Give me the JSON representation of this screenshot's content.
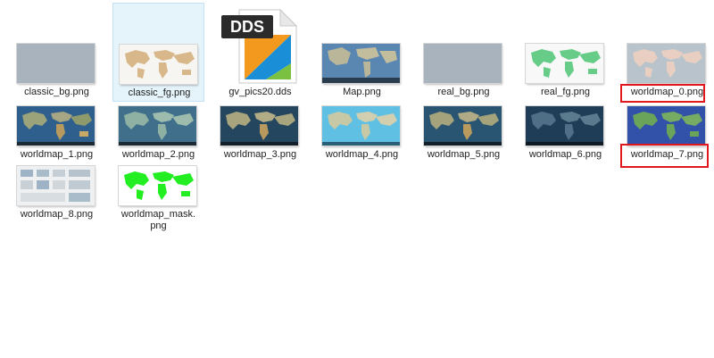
{
  "files": [
    {
      "name": "classic_bg.png"
    },
    {
      "name": "classic_fg.png"
    },
    {
      "name": "gv_pics20.dds",
      "badge": "DDS"
    },
    {
      "name": "Map.png"
    },
    {
      "name": "real_bg.png"
    },
    {
      "name": "real_fg.png"
    },
    {
      "name": "worldmap_0.png"
    },
    {
      "name": "worldmap_1.png"
    },
    {
      "name": "worldmap_2.png"
    },
    {
      "name": "worldmap_3.png"
    },
    {
      "name": "worldmap_4.png"
    },
    {
      "name": "worldmap_5.png"
    },
    {
      "name": "worldmap_6.png"
    },
    {
      "name": "worldmap_7.png"
    },
    {
      "name": "worldmap_8.png"
    },
    {
      "name": "worldmap_mask.\npng"
    }
  ],
  "colors": {
    "selection_bg": "#e5f3fb",
    "highlight": "#e0181d",
    "dds_orange": "#f39a1e",
    "dds_blue": "#1a8fd8",
    "dds_green": "#7ac142"
  }
}
